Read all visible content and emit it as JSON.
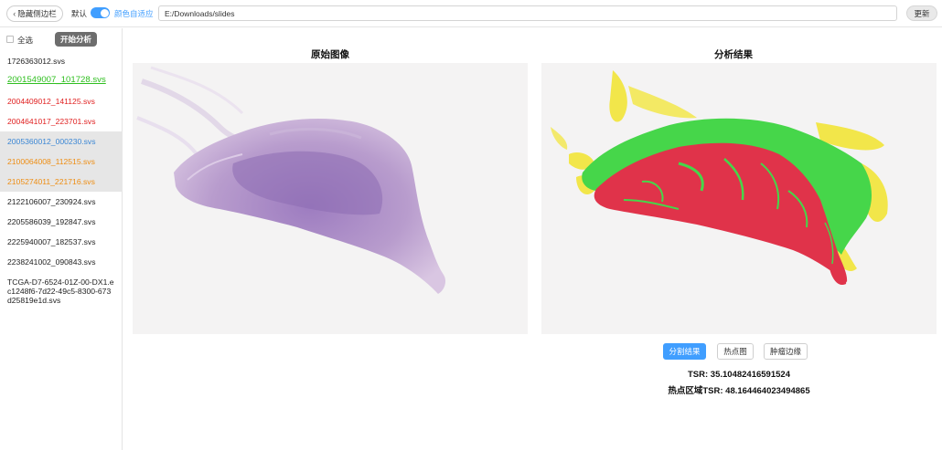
{
  "topbar": {
    "hide_sidebar_label": "隐藏侧边栏",
    "default_label": "默认",
    "color_adapt_label": "颜色自适应",
    "color_adapt_on": true,
    "path_value": "E:/Downloads/slides",
    "update_label": "更新"
  },
  "sidebar": {
    "select_all_label": "全选",
    "start_label": "开始分析",
    "files": [
      {
        "name": "1726363012.svs",
        "color": "#222222",
        "style": "normal"
      },
      {
        "name": "2001549007_101728.svs",
        "color": "#2fbf1f",
        "style": "big"
      },
      {
        "name": "2004409012_141125.svs",
        "color": "#e02020",
        "style": "normal"
      },
      {
        "name": "2004641017_223701.svs",
        "color": "#e02020",
        "style": "normal"
      },
      {
        "name": "2005360012_000230.svs",
        "color": "#3a86d4",
        "style": "shaded"
      },
      {
        "name": "2100064008_112515.svs",
        "color": "#ee8d12",
        "style": "shaded"
      },
      {
        "name": "2105274011_221716.svs",
        "color": "#ee8d12",
        "style": "shaded"
      },
      {
        "name": "2122106007_230924.svs",
        "color": "#222222",
        "style": "normal"
      },
      {
        "name": "2205586039_192847.svs",
        "color": "#222222",
        "style": "normal"
      },
      {
        "name": "2225940007_182537.svs",
        "color": "#222222",
        "style": "normal"
      },
      {
        "name": "2238241002_090843.svs",
        "color": "#222222",
        "style": "normal"
      },
      {
        "name": "TCGA-D7-6524-01Z-00-DX1.ec1248f6-7d22-49c5-8300-673d25819e1d.svs",
        "color": "#222222",
        "style": "tall"
      }
    ]
  },
  "main": {
    "original_title": "原始图像",
    "result_title": "分析结果",
    "buttons": {
      "segmentation": "分割结果",
      "hotspot": "热点图",
      "tumor_edge": "肿瘤边缘"
    },
    "tsr_text": "TSR: 35.10482416591524",
    "hotspot_tsr_text": "热点区域TSR: 48.164464023494865"
  },
  "colors": {
    "accent": "#409eff",
    "tissue_pink": "#b98fc6",
    "tumor_red": "#e0334a",
    "stroma_green": "#46d64a",
    "other_yellow": "#f2e64a"
  }
}
